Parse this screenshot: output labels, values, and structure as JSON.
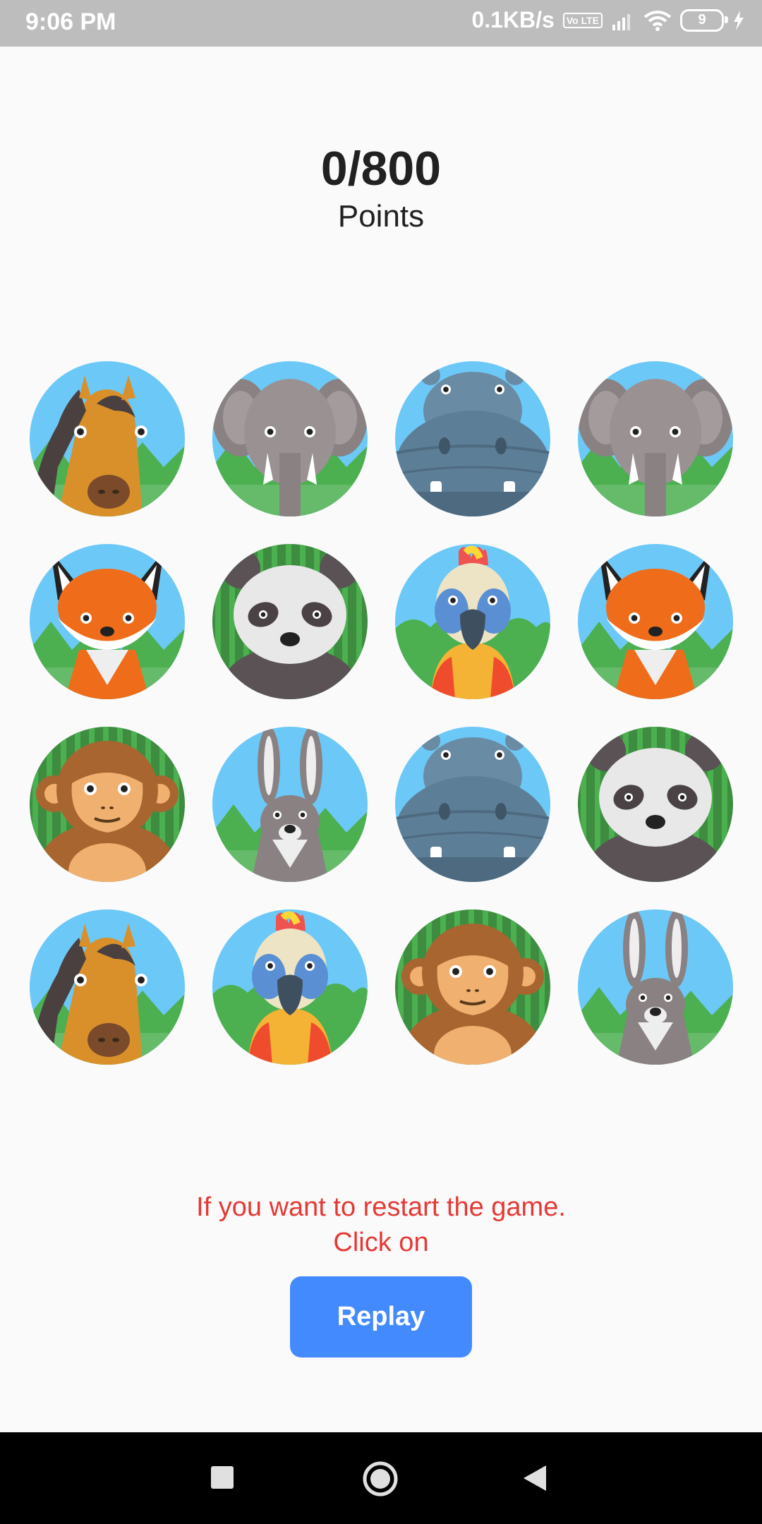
{
  "status_bar": {
    "time": "9:06 PM",
    "net_speed": "0.1KB/s",
    "volte": "Vo LTE",
    "battery": "9",
    "icons": [
      "signal-icon",
      "wifi-icon",
      "battery-icon",
      "charging-icon"
    ]
  },
  "game": {
    "score": "0/800",
    "score_label": "Points",
    "cards": [
      "horse",
      "elephant",
      "hippo",
      "elephant",
      "fox",
      "panda",
      "parrot",
      "fox",
      "monkey",
      "rabbit",
      "hippo",
      "panda",
      "horse",
      "parrot",
      "monkey",
      "rabbit"
    ]
  },
  "restart": {
    "line1": "If you want to restart the game.",
    "line2": "Click on",
    "button": "Replay"
  },
  "nav": {
    "icons": [
      "recents-icon",
      "home-icon",
      "back-icon"
    ]
  },
  "colors": {
    "accent": "#448aff",
    "message": "#e53935",
    "status_bar": "#bdbdbd"
  }
}
